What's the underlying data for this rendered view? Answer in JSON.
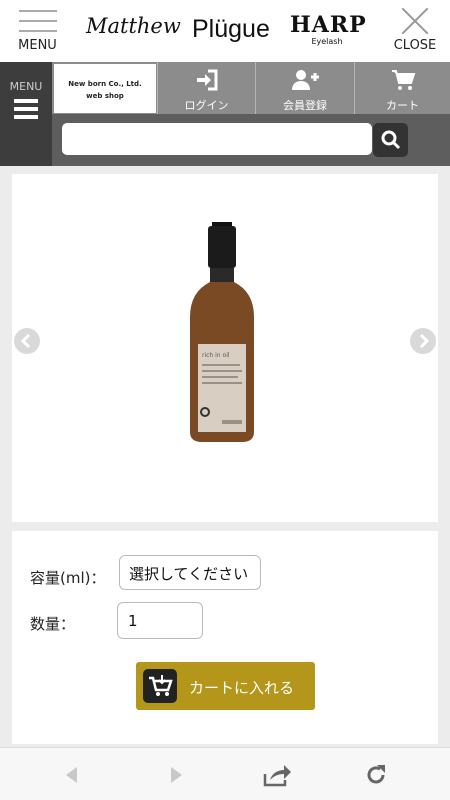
{
  "header": {
    "menu_label": "MENU",
    "brands": [
      "Matthew",
      "Plügue",
      "HARP",
      "Eyelash"
    ],
    "close_label": "CLOSE"
  },
  "nav": {
    "side_menu_label": "MENU",
    "shop_logo": [
      "New born Co., Ltd.",
      "web shop"
    ],
    "login_label": "ログイン",
    "register_label": "会員登録",
    "cart_label": "カート"
  },
  "search": {
    "placeholder": "",
    "value": ""
  },
  "product": {
    "image_icon": "amber-bottle-product-image",
    "bottle_label_text": "rich in oil"
  },
  "form": {
    "capacity_label": "容量(ml)：",
    "capacity_selected": "選択してください",
    "quantity_label": "数量：",
    "quantity_value": "1",
    "add_to_cart_label": "カートに入れる"
  },
  "colors": {
    "accent_gold": "#b3961a",
    "nav_gray": "#8c8c8c",
    "dark_gray": "#3d3d3d"
  }
}
